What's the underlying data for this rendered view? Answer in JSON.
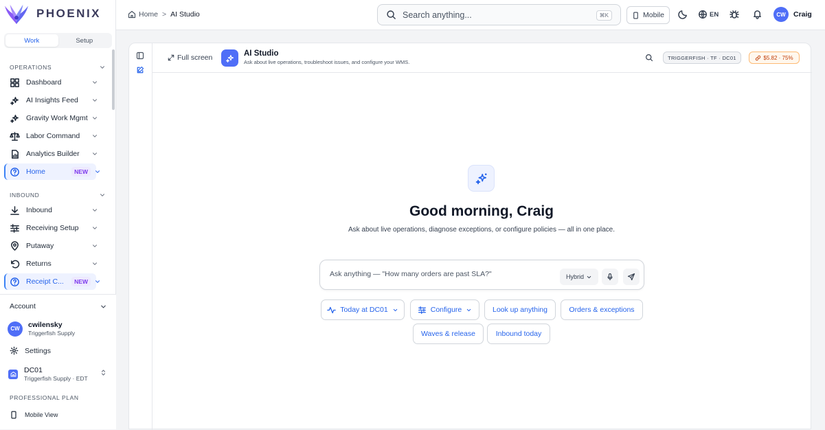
{
  "brand": {
    "name": "PHOENIX"
  },
  "sidebar": {
    "modes": [
      "Work",
      "Setup"
    ],
    "sections": {
      "operations": "OPERATIONS",
      "inbound": "INBOUND"
    },
    "items": [
      {
        "label": "Dashboard",
        "icon": "dashboard-icon"
      },
      {
        "label": "AI Insights Feed",
        "icon": "sparkle-icon"
      },
      {
        "label": "Gravity Work Mgmt",
        "icon": "sparkle-icon"
      },
      {
        "label": "Labor Command",
        "icon": "scale-icon"
      },
      {
        "label": "Analytics Builder",
        "icon": "report-icon"
      },
      {
        "label": "Home",
        "icon": "help-circle-icon",
        "badge": "NEW"
      },
      {
        "label": "Inbound",
        "icon": "download-icon"
      },
      {
        "label": "Receiving Setup",
        "icon": "sliders-icon"
      },
      {
        "label": "Putaway",
        "icon": "location-pin-icon"
      },
      {
        "label": "Returns",
        "icon": "return-icon"
      },
      {
        "label": "Receipt C...",
        "icon": "help-circle-icon",
        "badge": "NEW"
      }
    ],
    "account": {
      "title": "Account",
      "user_initials": "CW",
      "username": "cwilensky",
      "org": "Triggerfish Supply",
      "settings": "Settings",
      "facility": "DC01",
      "facility_sub": "Triggerfish Supply · EDT",
      "plan": "PROFESSIONAL PLAN",
      "mobile_view": "Mobile View"
    }
  },
  "topbar": {
    "breadcrumb_home": "Home",
    "breadcrumb_sep": ">",
    "breadcrumb_current": "AI Studio",
    "search_placeholder": "Search anything...",
    "search_shortcut": "⌘K",
    "mobile_label": "Mobile",
    "lang": "EN",
    "user_initials": "CW",
    "user_name": "Craig"
  },
  "studio": {
    "fullscreen": "Full screen",
    "title": "AI Studio",
    "subtitle": "Ask about live operations, troubleshoot issues, and configure your WMS.",
    "context_chip": "TRIGGERFISH · TF · DC01",
    "cost_chip": "$5.82 · 75%",
    "greeting": "Good morning, Craig",
    "tagline": "Ask about live operations, diagnose exceptions, or configure policies — all in one place.",
    "prompt_placeholder": "Ask anything — \"How many orders are past SLA?\"",
    "mode": "Hybrid",
    "suggestions": [
      "Today at DC01",
      "Configure",
      "Look up anything",
      "Orders & exceptions",
      "Waves & release",
      "Inbound today"
    ]
  },
  "colors": {
    "accent": "#2563eb",
    "badge": "#7c3aed",
    "avatar": "#4f6ef7",
    "cost_chip": "#c2410c"
  }
}
